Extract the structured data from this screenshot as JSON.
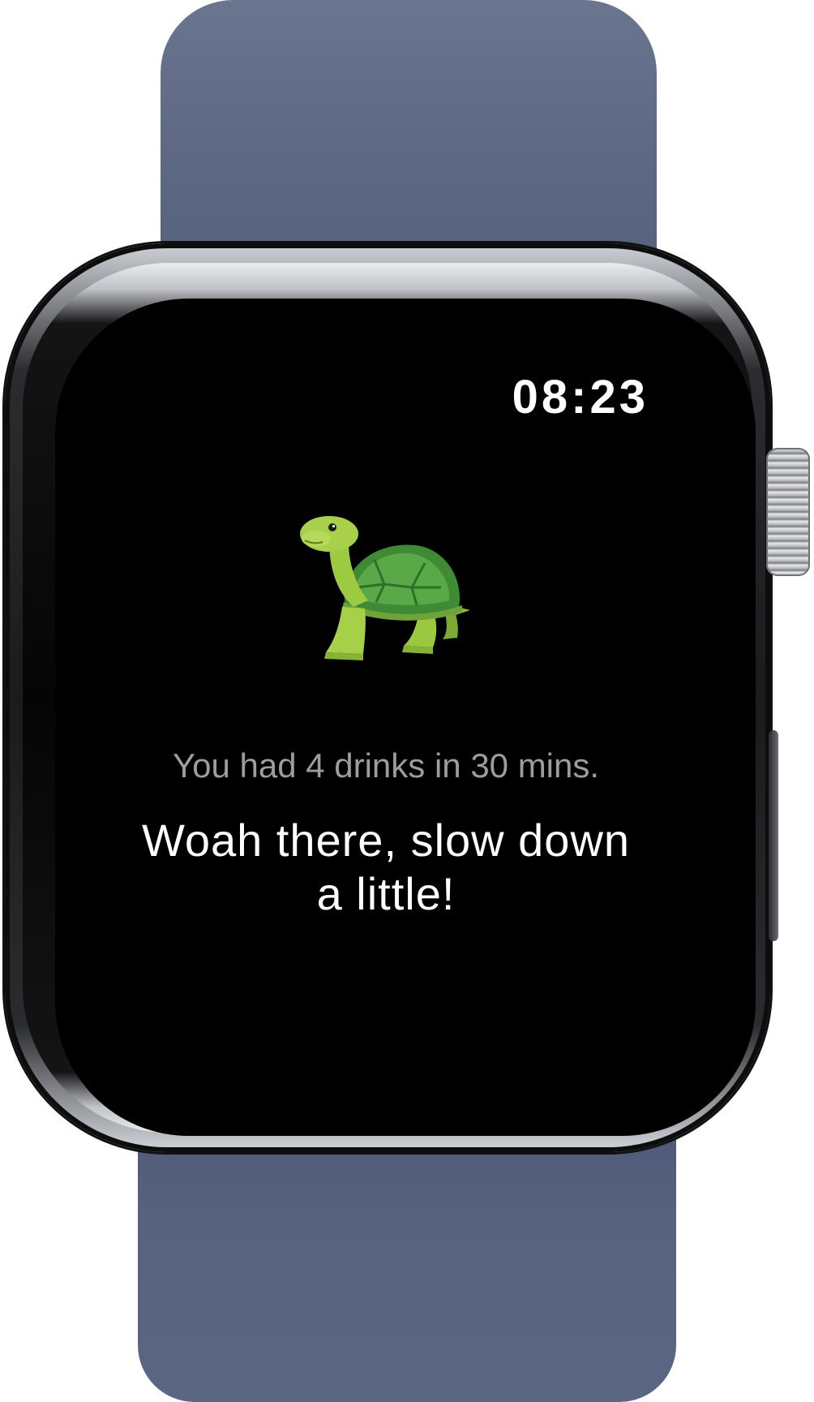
{
  "watch": {
    "band_color": "#5d6884",
    "screen_color": "#000000"
  },
  "status": {
    "time": "08:23"
  },
  "alert": {
    "icon": "turtle-icon",
    "message": "You had 4 drinks in 30 mins.",
    "headline": "Woah there, slow down a little!"
  }
}
